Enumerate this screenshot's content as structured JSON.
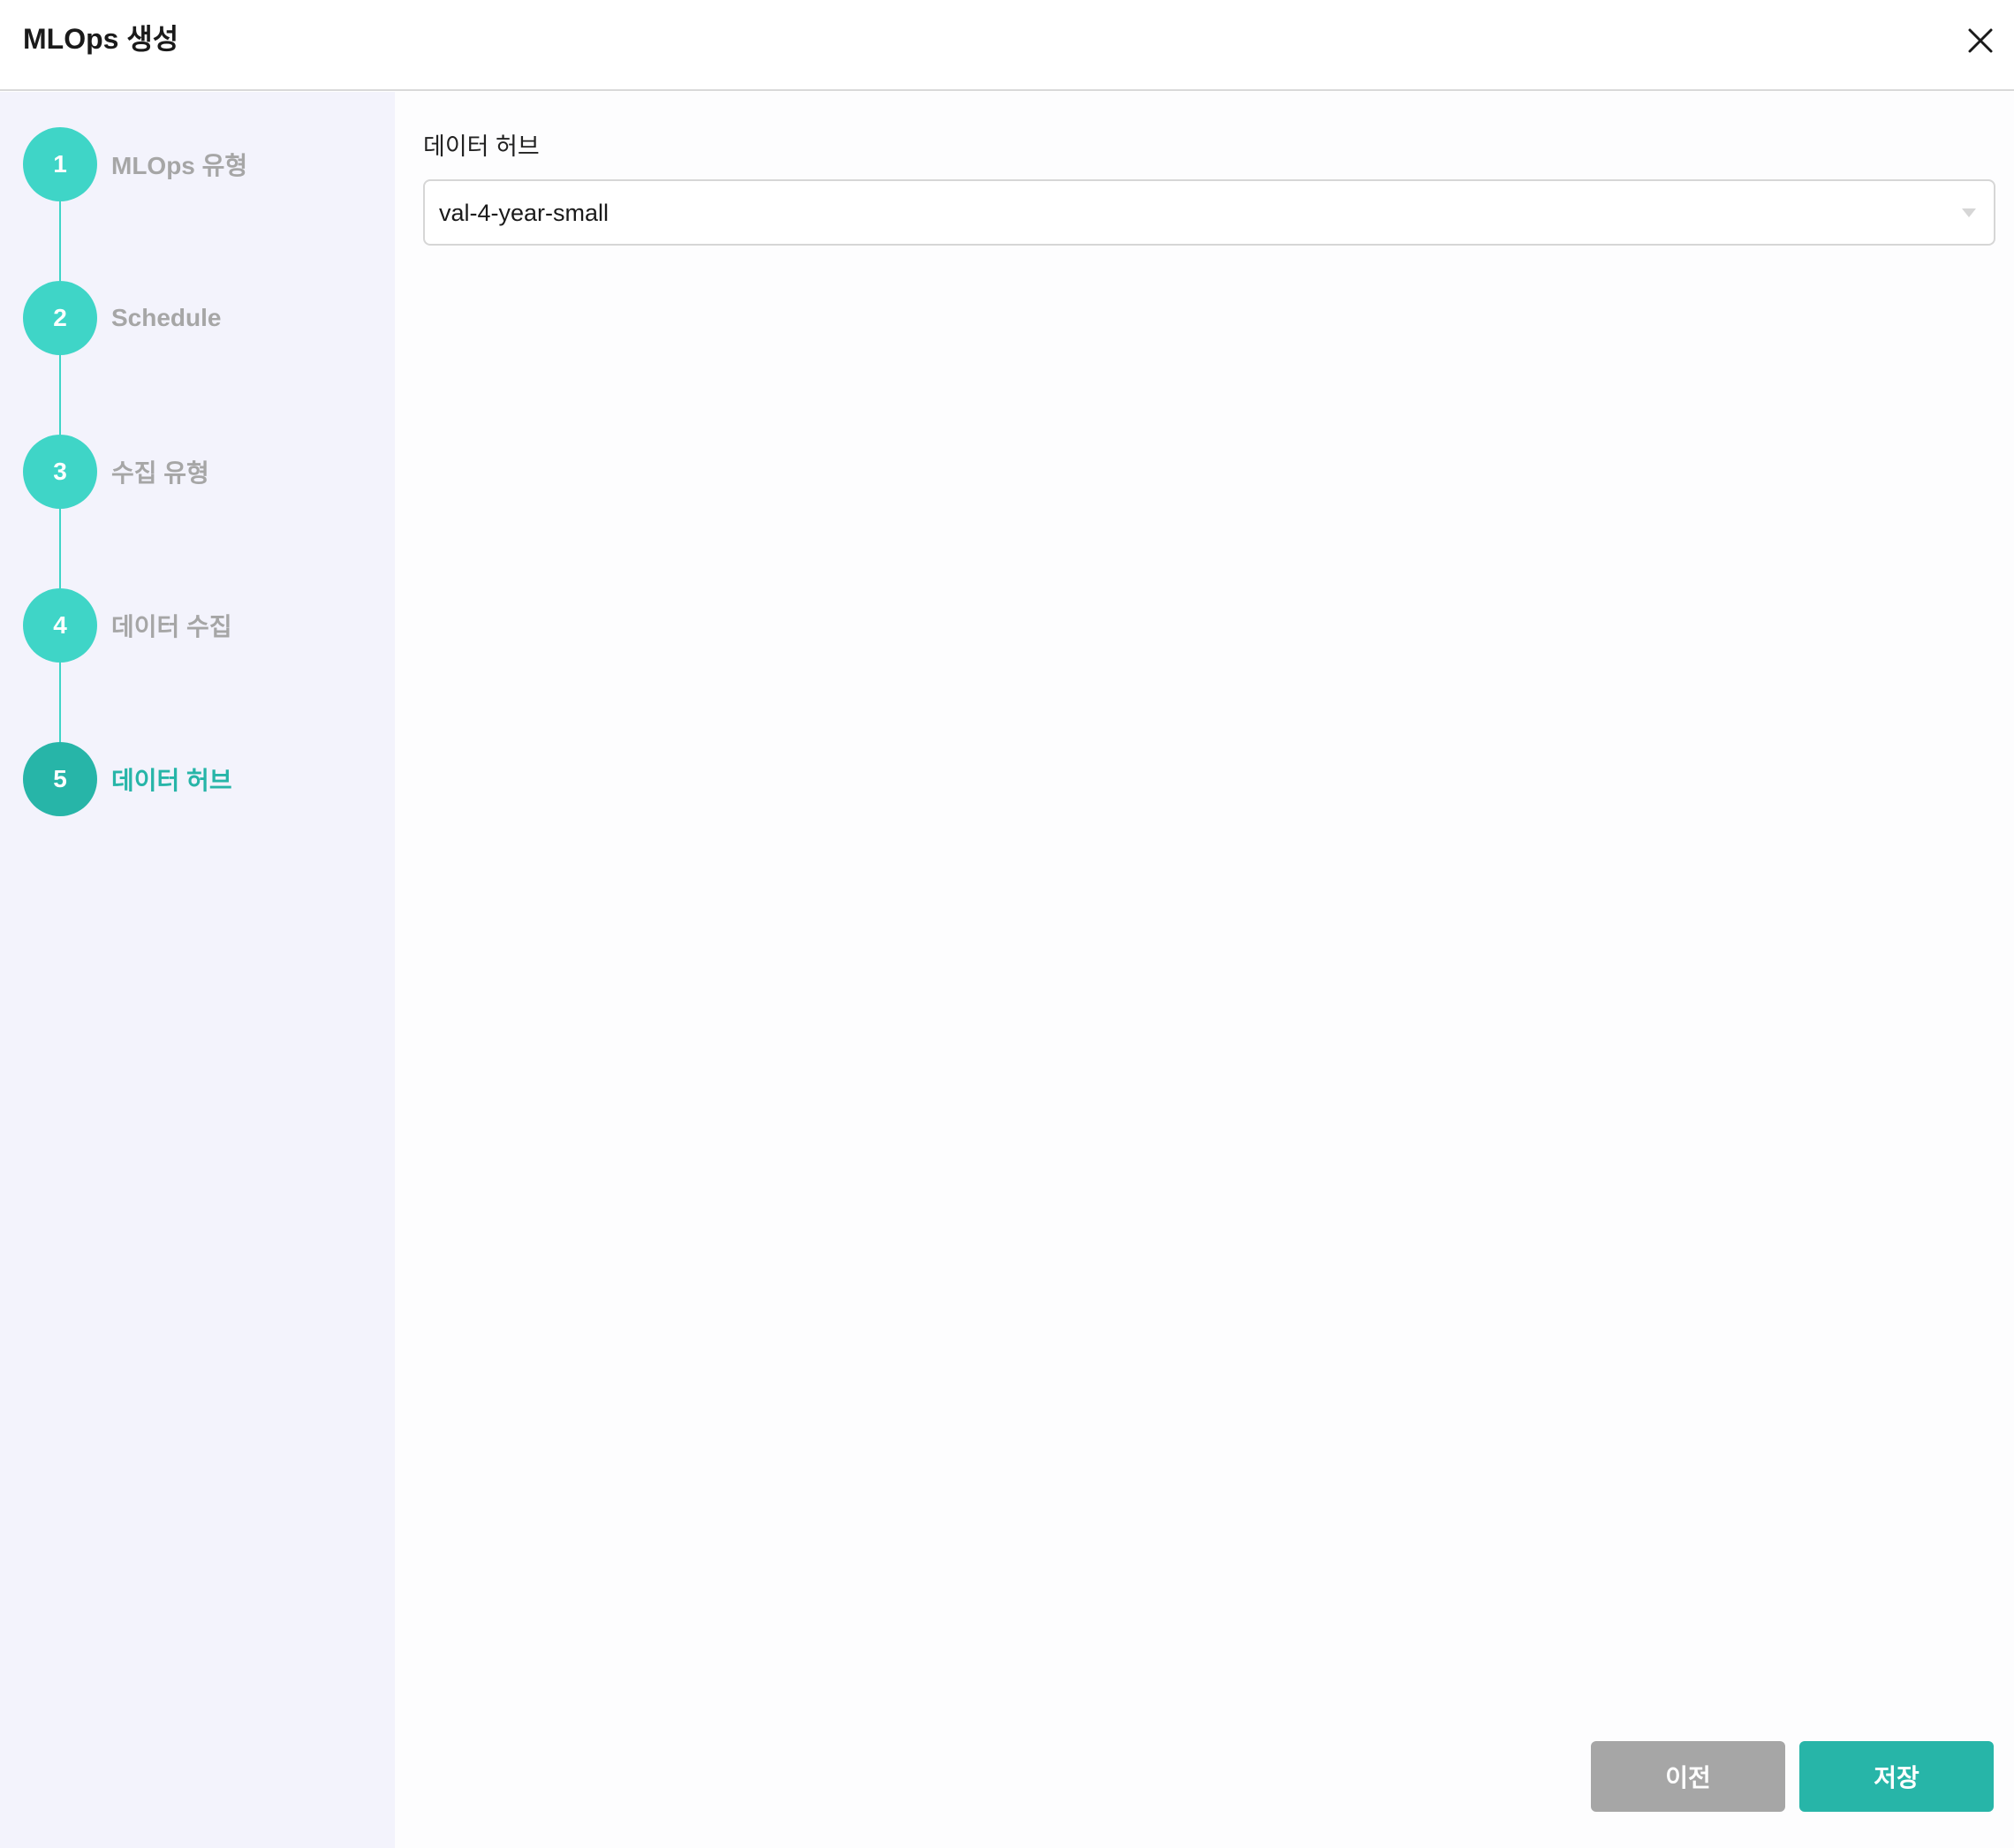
{
  "header": {
    "title": "MLOps 생성",
    "close_icon": "close-icon"
  },
  "steps": [
    {
      "number": "1",
      "label": "MLOps 유형",
      "state": "completed"
    },
    {
      "number": "2",
      "label": "Schedule",
      "state": "completed"
    },
    {
      "number": "3",
      "label": "수집 유형",
      "state": "completed"
    },
    {
      "number": "4",
      "label": "데이터 수집",
      "state": "completed"
    },
    {
      "number": "5",
      "label": "데이터 허브",
      "state": "active"
    }
  ],
  "form": {
    "data_hub_label": "데이터 허브",
    "data_hub_value": "val-4-year-small"
  },
  "buttons": {
    "prev_label": "이전",
    "save_label": "저장"
  },
  "colors": {
    "accent": "#3fd5c7",
    "accent_active": "#27b5a8",
    "sidebar_bg": "#f3f3fc",
    "muted": "#a6a6a6"
  }
}
